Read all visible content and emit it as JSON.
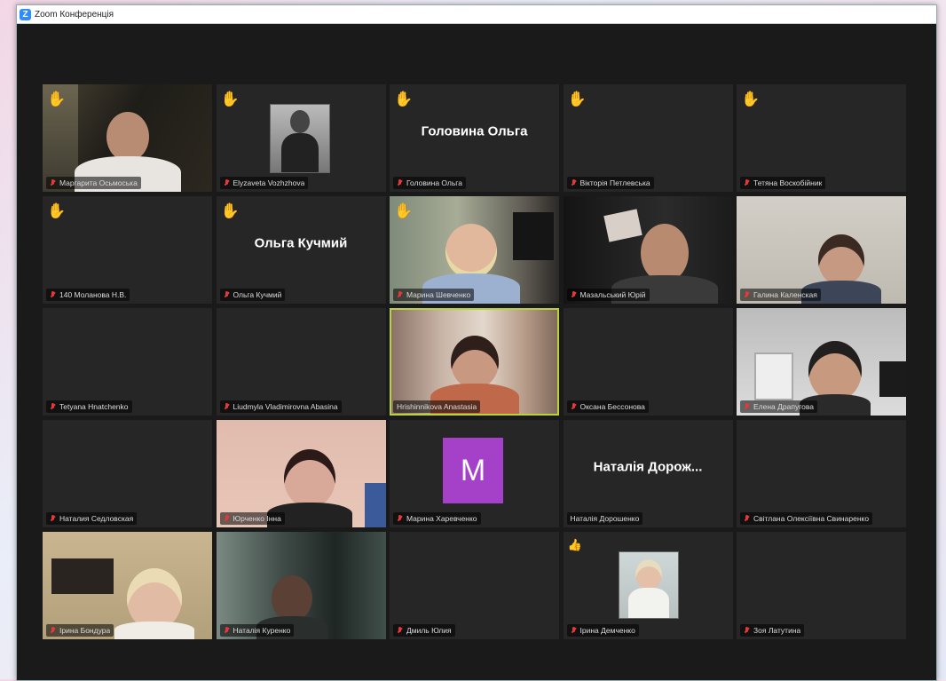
{
  "window": {
    "title": "Zoom Конференція",
    "logo_letter": "Z"
  },
  "tiles": [
    {
      "name": "Маргарита Осьмоська",
      "hand": true,
      "type": "video"
    },
    {
      "name": "Elyzaveta Vozhzhova",
      "hand": true,
      "type": "thumb"
    },
    {
      "name": "Головина Ольга",
      "hand": true,
      "type": "namecard",
      "display": "Головина Ольга"
    },
    {
      "name": "Вікторія Петлевська",
      "hand": true,
      "type": "blank"
    },
    {
      "name": "Тетяна Воскобійник",
      "hand": true,
      "type": "blank"
    },
    {
      "name": "140 Моланова Н.В.",
      "hand": true,
      "type": "blank"
    },
    {
      "name": "Ольга Кучмий",
      "hand": true,
      "type": "namecard",
      "display": "Ольга Кучмий"
    },
    {
      "name": "Марина Шевченко",
      "hand": true,
      "type": "video"
    },
    {
      "name": "Мазальський Юрій",
      "hand": false,
      "type": "video"
    },
    {
      "name": "Галина Каленская",
      "hand": false,
      "type": "video"
    },
    {
      "name": "Tetyana Hnatchenko",
      "hand": false,
      "type": "blank"
    },
    {
      "name": "Liudmyla Vladimirovna Abasina",
      "hand": false,
      "type": "blank"
    },
    {
      "name": "Hrishinnikova Anastasia",
      "hand": false,
      "type": "video",
      "active": true
    },
    {
      "name": "Оксана Бессонова",
      "hand": false,
      "type": "blank"
    },
    {
      "name": "Елена Драпугова",
      "hand": false,
      "type": "video"
    },
    {
      "name": "Наталия Седловская",
      "hand": false,
      "type": "blank"
    },
    {
      "name": "Юрченко Інна",
      "hand": false,
      "type": "video"
    },
    {
      "name": "Марина Харевченко",
      "hand": false,
      "type": "avatar",
      "avatar_letter": "M"
    },
    {
      "name": "Наталія Дорошенко",
      "hand": false,
      "type": "namecard",
      "display": "Наталія Дорож..."
    },
    {
      "name": "Світлана Олексіївна Свинаренко",
      "hand": false,
      "type": "blank"
    },
    {
      "name": "Ірина Бондура",
      "hand": false,
      "type": "video"
    },
    {
      "name": "Наталія Куренко",
      "hand": false,
      "type": "video"
    },
    {
      "name": "Дмиль Юлия",
      "hand": false,
      "type": "blank"
    },
    {
      "name": "Ірина Демченко",
      "hand": true,
      "type": "thumb"
    },
    {
      "name": "Зоя Латутина",
      "hand": false,
      "type": "blank"
    }
  ],
  "colors": {
    "hand": "#f4b400",
    "active_border": "#b8d43a",
    "avatar_bg": "#a540c8",
    "tile_bg": "#262626"
  },
  "icons": {
    "hand": "raised-hand-icon",
    "mic": "muted-mic-icon"
  }
}
